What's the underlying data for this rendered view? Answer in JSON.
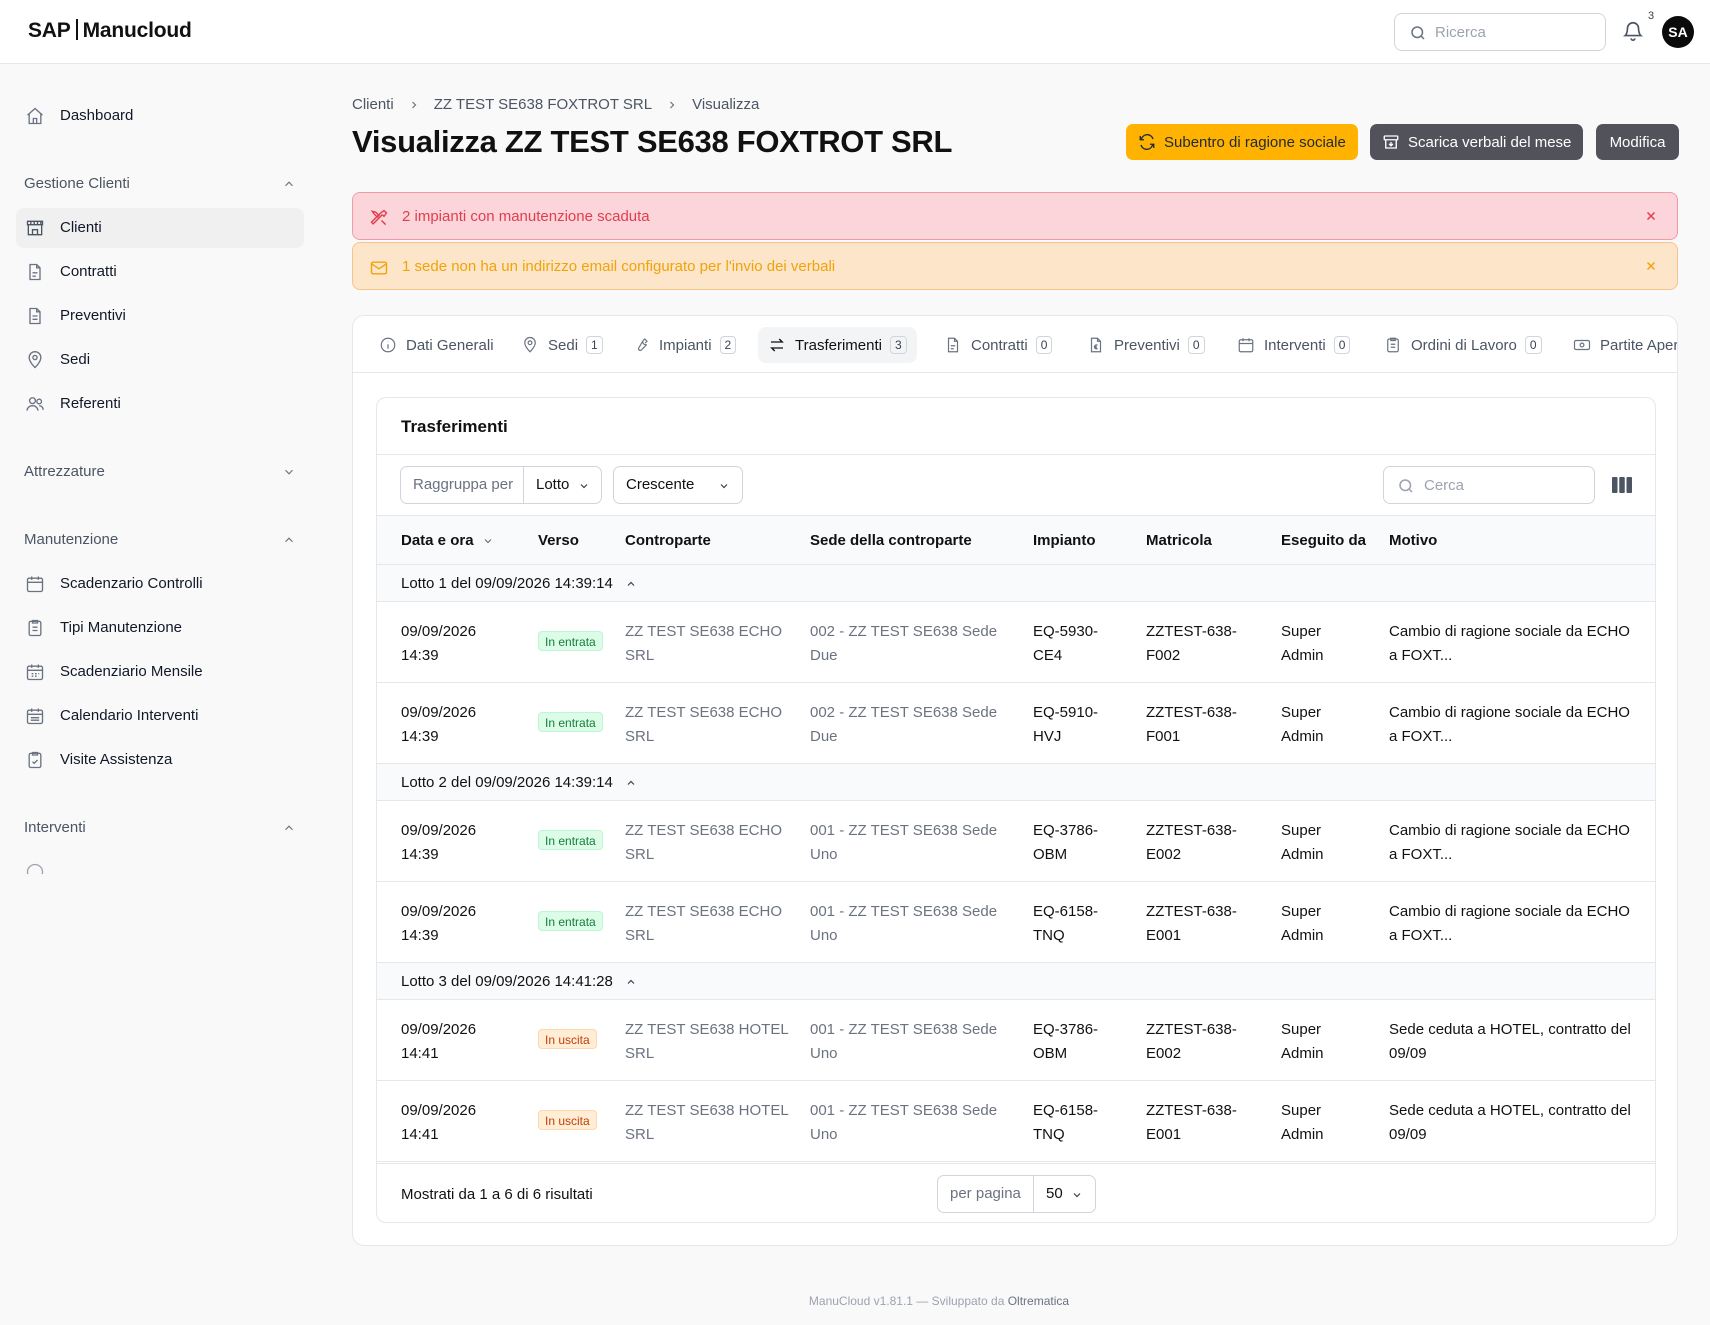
{
  "app": {
    "brand_left": "SAP",
    "brand_right": "Manucloud"
  },
  "topbar": {
    "search_placeholder": "Ricerca",
    "notifications_count": "3",
    "avatar_initials": "SA"
  },
  "sidebar": {
    "dashboard": "Dashboard",
    "groups": [
      {
        "label": "Gestione Clienti",
        "expanded": true,
        "items": [
          "Clienti",
          "Contratti",
          "Preventivi",
          "Sedi",
          "Referenti"
        ]
      },
      {
        "label": "Attrezzature",
        "expanded": false,
        "items": []
      },
      {
        "label": "Manutenzione",
        "expanded": true,
        "items": [
          "Scadenzario Controlli",
          "Tipi Manutenzione",
          "Scadenziario Mensile",
          "Calendario Interventi",
          "Visite Assistenza"
        ]
      },
      {
        "label": "Interventi",
        "expanded": true,
        "items": []
      }
    ],
    "active_item": "Clienti"
  },
  "breadcrumb": [
    "Clienti",
    "ZZ TEST SE638 FOXTROT SRL",
    "Visualizza"
  ],
  "page": {
    "title": "Visualizza ZZ TEST SE638 FOXTROT SRL"
  },
  "actions": {
    "subentro": "Subentro di ragione sociale",
    "scarica": "Scarica verbali del mese",
    "modifica": "Modifica"
  },
  "alerts": {
    "maintenance": "2 impianti con manutenzione scaduta",
    "email": "1 sede non ha un indirizzo email configurato per l'invio dei verbali"
  },
  "tabs": [
    {
      "label": "Dati Generali",
      "count": ""
    },
    {
      "label": "Sedi",
      "count": "1"
    },
    {
      "label": "Impianti",
      "count": "2"
    },
    {
      "label": "Trasferimenti",
      "count": "3"
    },
    {
      "label": "Contratti",
      "count": "0"
    },
    {
      "label": "Preventivi",
      "count": "0"
    },
    {
      "label": "Interventi",
      "count": "0"
    },
    {
      "label": "Ordini di Lavoro",
      "count": "0"
    },
    {
      "label": "Partite Aper",
      "count": ""
    }
  ],
  "active_tab": "Trasferimenti",
  "table": {
    "title": "Trasferimenti",
    "group_by_label": "Raggruppa per",
    "group_by_value": "Lotto",
    "order_value": "Crescente",
    "search_placeholder": "Cerca",
    "columns": [
      "Data e ora",
      "Verso",
      "Controparte",
      "Sede della controparte",
      "Impianto",
      "Matricola",
      "Eseguito da",
      "Motivo"
    ],
    "groups": [
      {
        "label": "Lotto 1 del 09/09/2026 14:39:14",
        "rows": [
          {
            "date": "09/09/2026",
            "time": "14:39",
            "verso": "In entrata",
            "controparte_1": "ZZ TEST SE638 ECHO",
            "controparte_2": "SRL",
            "sede_1": "002 - ZZ TEST SE638 Sede",
            "sede_2": "Due",
            "impianto_1": "EQ-5930-",
            "impianto_2": "CE4",
            "matricola_1": "ZZTEST-638-",
            "matricola_2": "F002",
            "eseguito_1": "Super",
            "eseguito_2": "Admin",
            "motivo_1": "Cambio di ragione sociale da ECHO",
            "motivo_2": "a FOXT..."
          },
          {
            "date": "09/09/2026",
            "time": "14:39",
            "verso": "In entrata",
            "controparte_1": "ZZ TEST SE638 ECHO",
            "controparte_2": "SRL",
            "sede_1": "002 - ZZ TEST SE638 Sede",
            "sede_2": "Due",
            "impianto_1": "EQ-5910-",
            "impianto_2": "HVJ",
            "matricola_1": "ZZTEST-638-",
            "matricola_2": "F001",
            "eseguito_1": "Super",
            "eseguito_2": "Admin",
            "motivo_1": "Cambio di ragione sociale da ECHO",
            "motivo_2": "a FOXT..."
          }
        ]
      },
      {
        "label": "Lotto 2 del 09/09/2026 14:39:14",
        "rows": [
          {
            "date": "09/09/2026",
            "time": "14:39",
            "verso": "In entrata",
            "controparte_1": "ZZ TEST SE638 ECHO",
            "controparte_2": "SRL",
            "sede_1": "001 - ZZ TEST SE638 Sede",
            "sede_2": "Uno",
            "impianto_1": "EQ-3786-",
            "impianto_2": "OBM",
            "matricola_1": "ZZTEST-638-",
            "matricola_2": "E002",
            "eseguito_1": "Super",
            "eseguito_2": "Admin",
            "motivo_1": "Cambio di ragione sociale da ECHO",
            "motivo_2": "a FOXT..."
          },
          {
            "date": "09/09/2026",
            "time": "14:39",
            "verso": "In entrata",
            "controparte_1": "ZZ TEST SE638 ECHO",
            "controparte_2": "SRL",
            "sede_1": "001 - ZZ TEST SE638 Sede",
            "sede_2": "Uno",
            "impianto_1": "EQ-6158-",
            "impianto_2": "TNQ",
            "matricola_1": "ZZTEST-638-",
            "matricola_2": "E001",
            "eseguito_1": "Super",
            "eseguito_2": "Admin",
            "motivo_1": "Cambio di ragione sociale da ECHO",
            "motivo_2": "a FOXT..."
          }
        ]
      },
      {
        "label": "Lotto 3 del 09/09/2026 14:41:28",
        "rows": [
          {
            "date": "09/09/2026",
            "time": "14:41",
            "verso": "In uscita",
            "controparte_1": "ZZ TEST SE638 HOTEL",
            "controparte_2": "SRL",
            "sede_1": "001 - ZZ TEST SE638 Sede",
            "sede_2": "Uno",
            "impianto_1": "EQ-3786-",
            "impianto_2": "OBM",
            "matricola_1": "ZZTEST-638-",
            "matricola_2": "E002",
            "eseguito_1": "Super",
            "eseguito_2": "Admin",
            "motivo_1": "Sede ceduta a HOTEL, contratto del",
            "motivo_2": "09/09"
          },
          {
            "date": "09/09/2026",
            "time": "14:41",
            "verso": "In uscita",
            "controparte_1": "ZZ TEST SE638 HOTEL",
            "controparte_2": "SRL",
            "sede_1": "001 - ZZ TEST SE638 Sede",
            "sede_2": "Uno",
            "impianto_1": "EQ-6158-",
            "impianto_2": "TNQ",
            "matricola_1": "ZZTEST-638-",
            "matricola_2": "E001",
            "eseguito_1": "Super",
            "eseguito_2": "Admin",
            "motivo_1": "Sede ceduta a HOTEL, contratto del",
            "motivo_2": "09/09"
          }
        ]
      }
    ],
    "results_text": "Mostrati da 1 a 6 di 6 risultati",
    "per_page_label": "per pagina",
    "per_page_value": "50"
  },
  "footer": {
    "text": "ManuCloud v1.81.1 — Sviluppato da",
    "brand": "Oltrematica"
  },
  "colors": {
    "accent_yellow": "#ffb300",
    "dark_button": "#52525b",
    "alert_red": "#e23d4f",
    "alert_orange": "#f0a30a"
  }
}
